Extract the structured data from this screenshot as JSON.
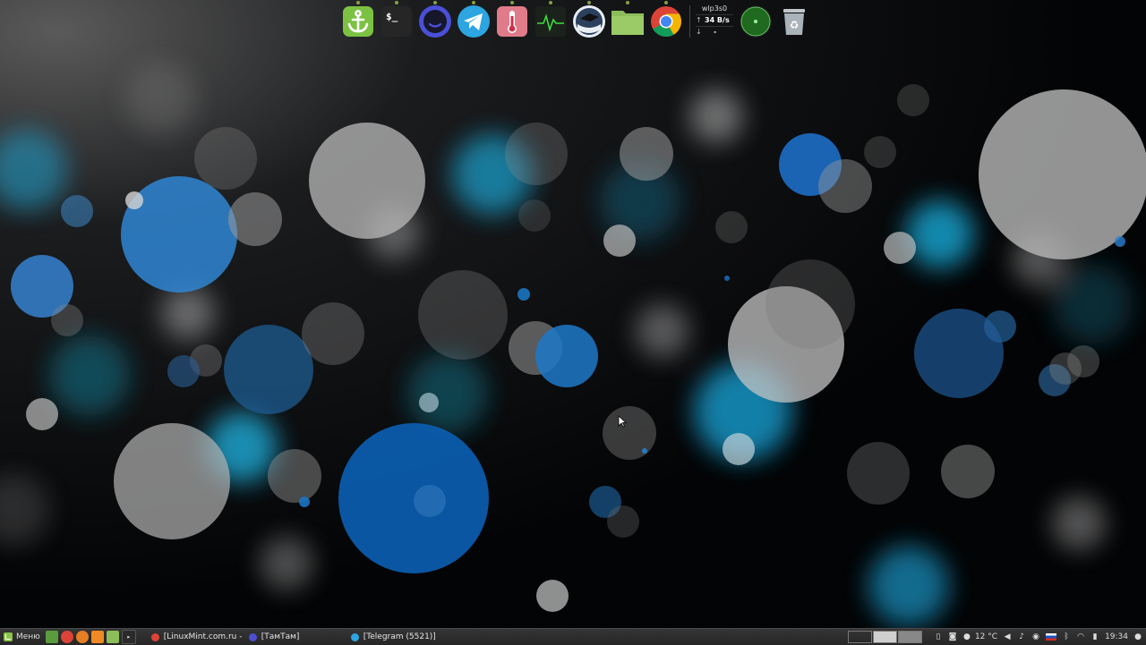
{
  "dock": {
    "items": [
      {
        "name": "anchor-icon",
        "color": "#7cc242"
      },
      {
        "name": "terminal-icon",
        "color": "#2b2b2b",
        "glyph": "$_"
      },
      {
        "name": "tamtam-icon",
        "color": "#4b4fd1"
      },
      {
        "name": "telegram-icon",
        "color": "#2ca5e0"
      },
      {
        "name": "thermometer-icon",
        "color": "#e06a7a"
      },
      {
        "name": "system-monitor-icon",
        "color": "#1f2a1f"
      },
      {
        "name": "mintupdate-icon",
        "color": "#2a3d5a"
      },
      {
        "name": "files-icon",
        "color": "#8cbd5a"
      },
      {
        "name": "chrome-icon",
        "color": "#db4437"
      }
    ],
    "netmon": {
      "interface": "wlp3s0",
      "up": "34 B/s",
      "down": "-"
    },
    "radar": {
      "name": "radar-icon",
      "color": "#2e8b2e"
    },
    "trash": {
      "name": "trash-icon"
    }
  },
  "panel": {
    "menu_label": "Меню",
    "tasks": [
      {
        "label": "[LinuxMint.com.ru - Н...",
        "icon": "chrome-icon",
        "color": "#db4437"
      },
      {
        "label": "[ТамТам]",
        "icon": "tamtam-icon",
        "color": "#4b4fd1"
      },
      {
        "label": "[Telegram (5521)]",
        "icon": "telegram-icon",
        "color": "#2ca5e0"
      }
    ],
    "temperature": "12 °C",
    "time": "19:34"
  }
}
